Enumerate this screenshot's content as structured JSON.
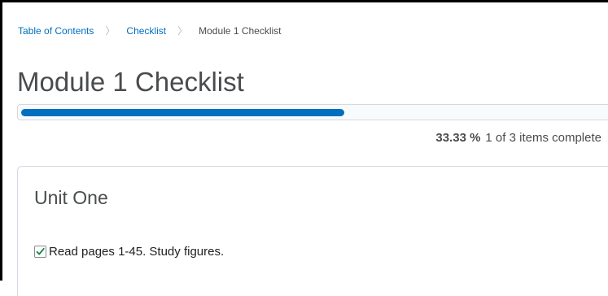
{
  "breadcrumb": {
    "items": [
      {
        "label": "Table of Contents"
      },
      {
        "label": "Checklist"
      }
    ],
    "current": "Module 1 Checklist",
    "separator": "〉"
  },
  "page": {
    "title": "Module 1 Checklist"
  },
  "progress": {
    "fraction": 0.3333,
    "percent_label": "33.33 %",
    "summary": "1 of 3 items complete",
    "fill_color": "#006fbf"
  },
  "unit": {
    "title": "Unit One",
    "items": [
      {
        "label": "Read pages 1-45. Study figures.",
        "checked": true
      }
    ]
  }
}
